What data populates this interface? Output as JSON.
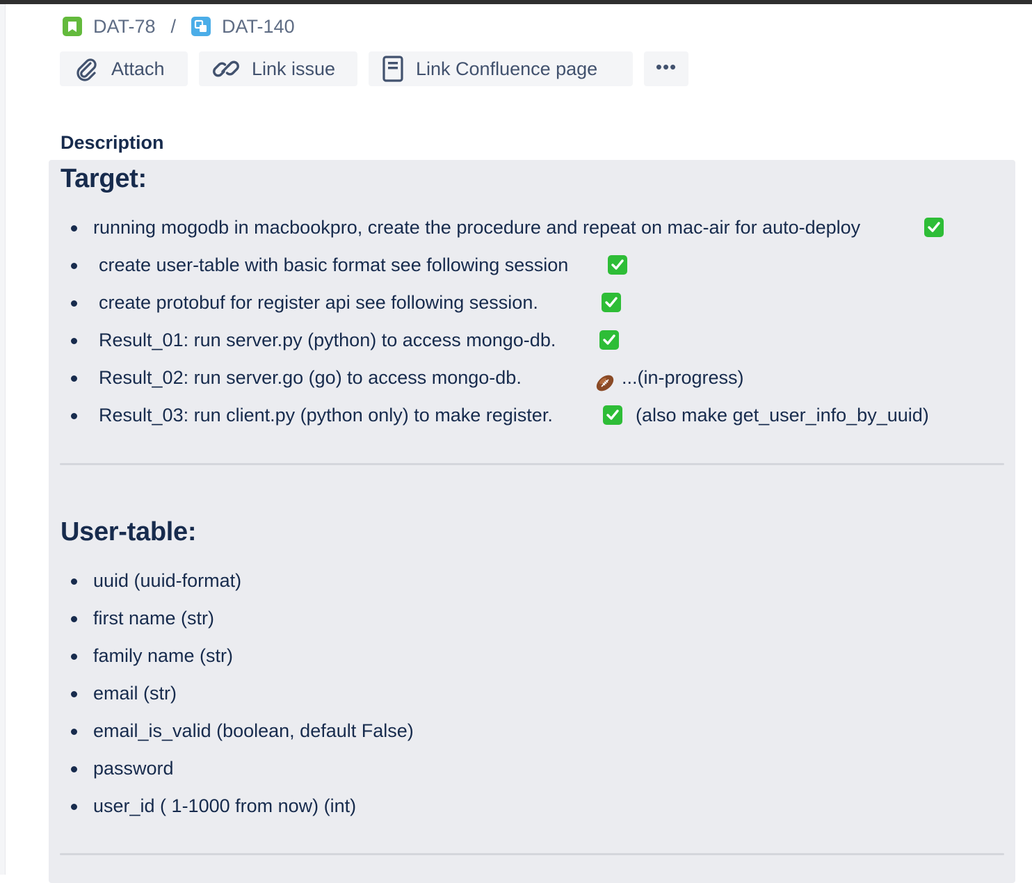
{
  "breadcrumb": {
    "parent": "DAT-78",
    "separator": "/",
    "current": "DAT-140",
    "parent_icon": "story-icon",
    "current_icon": "subtask-icon"
  },
  "toolbar": {
    "attach_label": "Attach",
    "link_issue_label": "Link issue",
    "link_confluence_label": "Link Confluence page",
    "more_label": "•••"
  },
  "description": {
    "label": "Description",
    "target_heading": "Target:",
    "target_items": [
      {
        "text": "running mogodb in macbookpro, create the procedure and repeat on mac-air for auto-deploy",
        "status": "done"
      },
      {
        "text": "create user-table with basic format see following session",
        "status": "done"
      },
      {
        "text": "create protobuf for register api see following session.",
        "status": "done"
      },
      {
        "text": "Result_01: run server.py (python) to access mongo-db.",
        "status": "done"
      },
      {
        "text": "Result_02: run server.go (go) to access mongo-db.",
        "status": "in-progress",
        "note": "...(in-progress)"
      },
      {
        "text": "Result_03: run client.py (python only) to make register.",
        "status": "done",
        "note": "(also make get_user_info_by_uuid)"
      }
    ],
    "user_table_heading": "User-table:",
    "user_table_items": [
      "uuid (uuid-format)",
      "first name (str)",
      "family name (str)",
      "email (str)",
      "email_is_valid (boolean, default False)",
      "password",
      "user_id ( 1-1000 from now) (int)"
    ]
  },
  "colors": {
    "check_green": "#2ebd37",
    "story_green": "#63ba3c",
    "subtask_blue": "#4bade8",
    "desc_bg": "#ebecf0"
  }
}
